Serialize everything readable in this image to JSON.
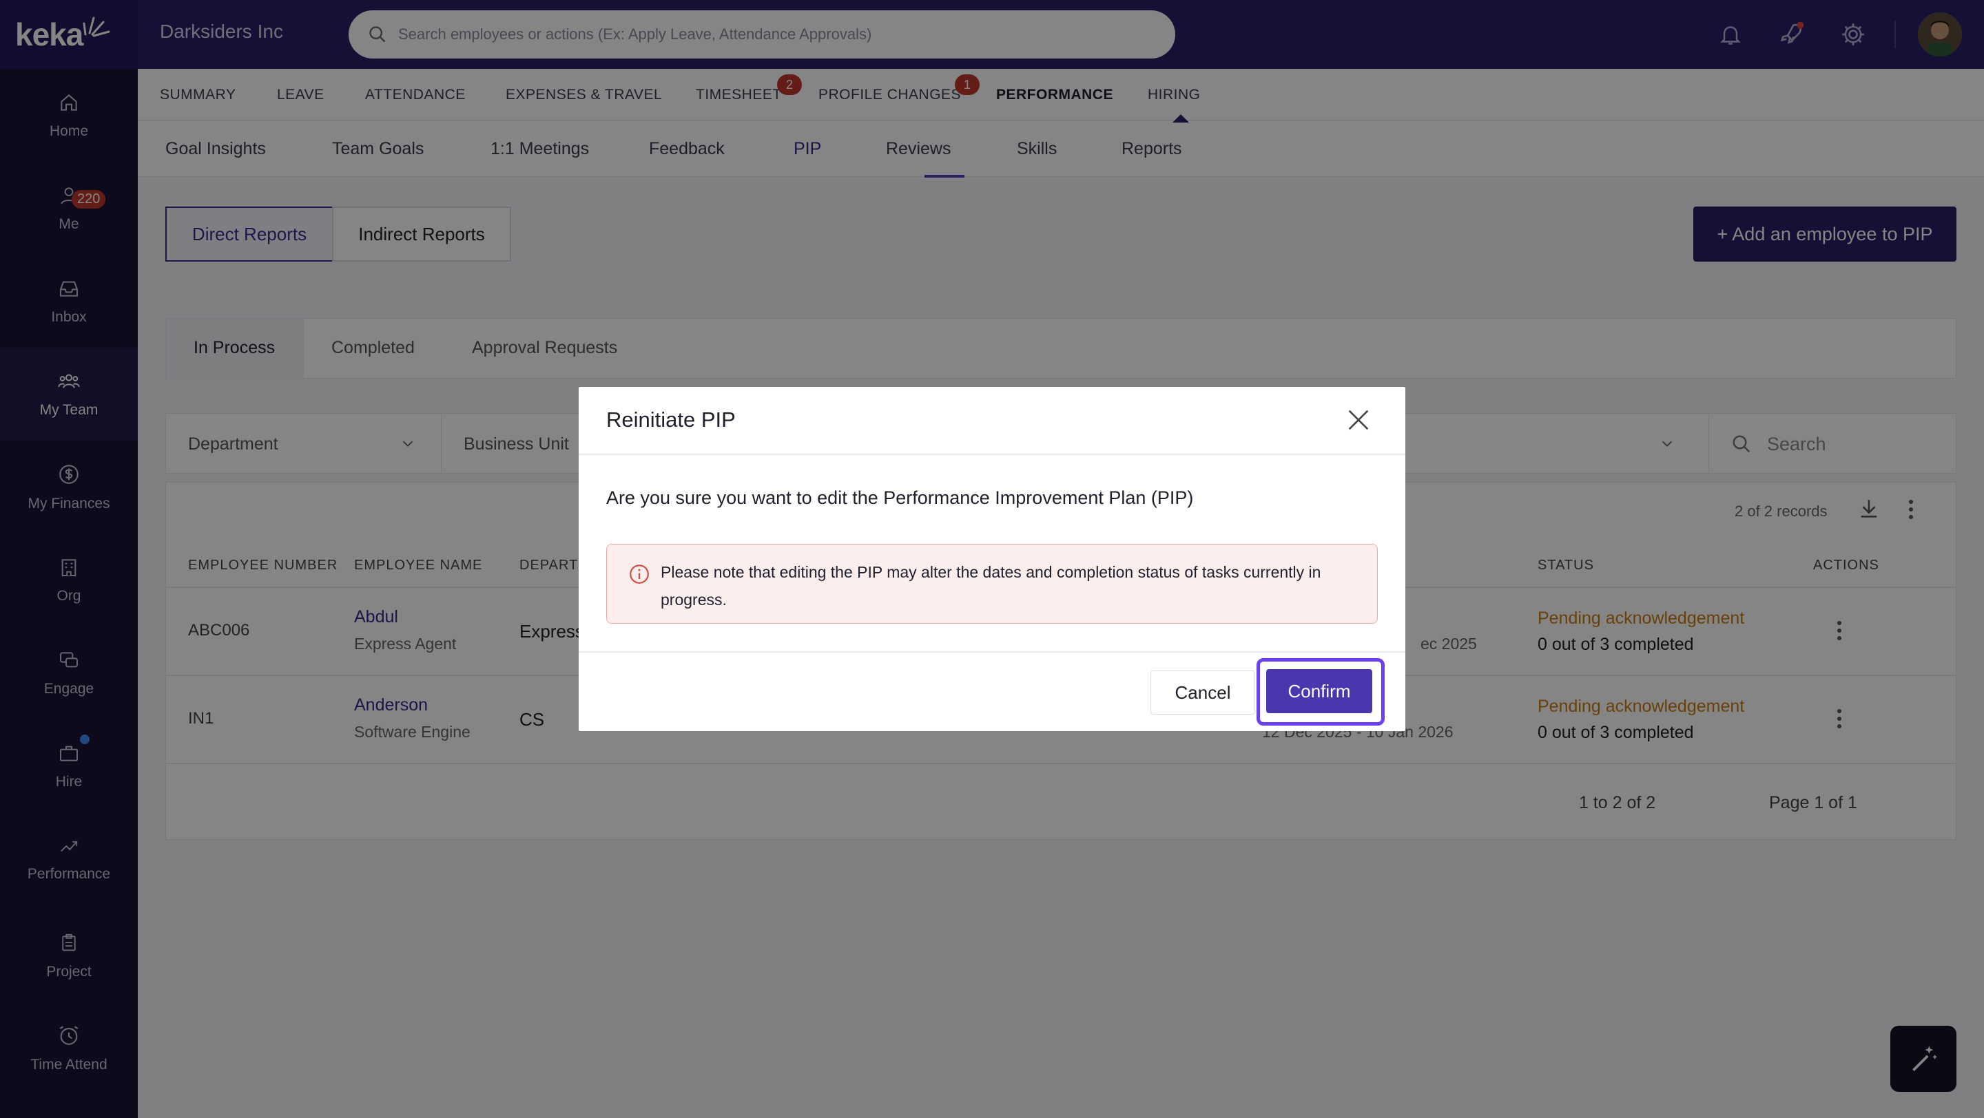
{
  "app": {
    "logo_text": "keka",
    "company": "Darksiders Inc",
    "search_placeholder": "Search employees or actions (Ex: Apply Leave, Attendance Approvals)"
  },
  "sidebar": {
    "items": [
      {
        "label": "Home",
        "icon": "home-icon"
      },
      {
        "label": "Me",
        "icon": "person-icon"
      },
      {
        "label": "Inbox",
        "icon": "inbox-icon",
        "badge": "220"
      },
      {
        "label": "My Team",
        "icon": "team-icon",
        "active": true
      },
      {
        "label": "My Finances",
        "icon": "dollar-icon"
      },
      {
        "label": "Org",
        "icon": "building-icon"
      },
      {
        "label": "Engage",
        "icon": "chat-icon"
      },
      {
        "label": "Hire",
        "icon": "briefcase-icon"
      },
      {
        "label": "Performance",
        "icon": "trend-icon"
      },
      {
        "label": "Project",
        "icon": "clipboard-icon"
      },
      {
        "label": "Time Attend",
        "icon": "clock-icon"
      }
    ]
  },
  "main_nav": {
    "items": [
      "SUMMARY",
      "LEAVE",
      "ATTENDANCE",
      "EXPENSES & TRAVEL",
      "TIMESHEET",
      "PROFILE CHANGES",
      "PERFORMANCE",
      "HIRING"
    ],
    "timesheet_badge": "2",
    "profile_badge": "1",
    "active": "PERFORMANCE"
  },
  "sub_nav": {
    "items": [
      "Goal Insights",
      "Team Goals",
      "1:1 Meetings",
      "Feedback",
      "PIP",
      "Reviews",
      "Skills",
      "Reports"
    ],
    "active": "PIP"
  },
  "reports_toggle": {
    "direct": "Direct Reports",
    "indirect": "Indirect Reports"
  },
  "add_button": "+ Add an employee to PIP",
  "status_tabs": [
    "In Process",
    "Completed",
    "Approval Requests"
  ],
  "filters": {
    "department": "Department",
    "business_unit": "Business Unit",
    "search_placeholder": "Search"
  },
  "table": {
    "records": "2 of 2 records",
    "headers": [
      "EMPLOYEE NUMBER",
      "EMPLOYEE NAME",
      "DEPARTM",
      "STATUS",
      "ACTIONS"
    ],
    "rows": [
      {
        "number": "ABC006",
        "name": "Abdul",
        "title": "Express Agent",
        "dept": "Express",
        "dates": "ec 2025",
        "status": "Pending acknowledgement",
        "progress": "0 out of 3 completed"
      },
      {
        "number": "IN1",
        "name": "Anderson",
        "title": "Software Engine",
        "dept": "CS",
        "dates": "12 Dec 2025 - 10 Jan 2026",
        "status": "Pending acknowledgement",
        "progress": "0 out of 3 completed"
      }
    ],
    "range": "1 to 2 of 2",
    "page": "Page 1 of 1"
  },
  "modal": {
    "title": "Reinitiate PIP",
    "question": "Are you sure you want to edit the Performance Improvement Plan (PIP)",
    "warning": "Please note that editing the PIP may alter the dates and completion status of tasks currently in progress.",
    "cancel": "Cancel",
    "confirm": "Confirm"
  },
  "colors": {
    "topbar": "#2a1f66",
    "sidebar": "#171535",
    "accent": "#4a37b0",
    "highlight": "#6a40f0",
    "pending": "#c77d12",
    "badge": "#c0392b"
  }
}
